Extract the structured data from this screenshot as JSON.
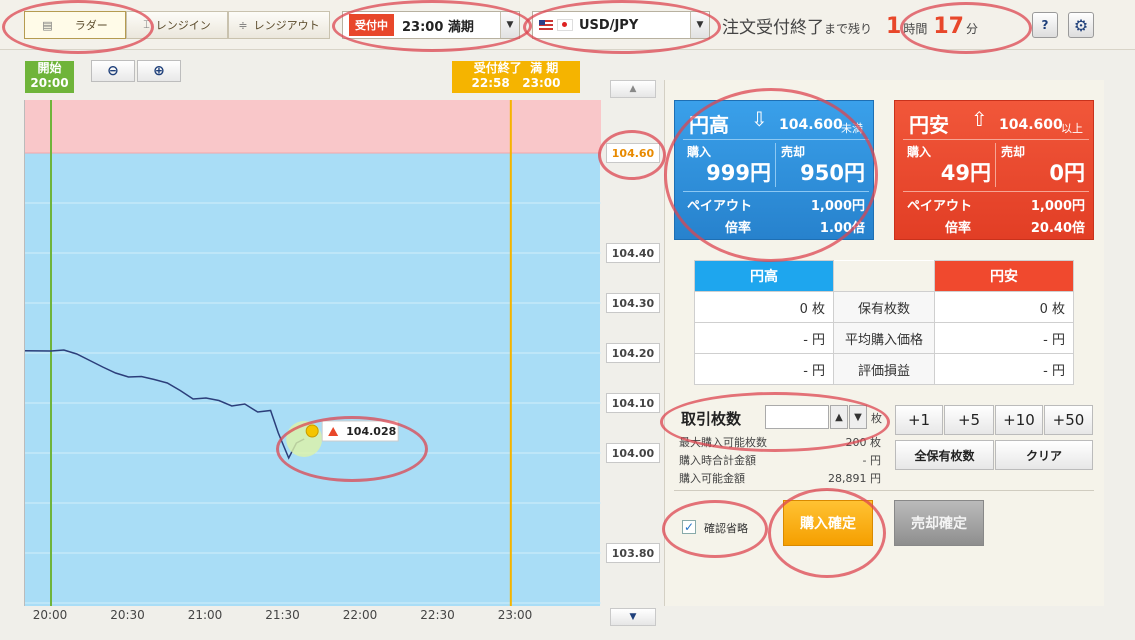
{
  "toolbar": {
    "tabs": [
      "ラダー",
      "レンジイン",
      "レンジアウト"
    ],
    "status_badge": "受付中",
    "expiry": "23:00 満期",
    "pair": "USD/JPY",
    "remaining_label": "注文受付終了",
    "remaining_suffix": "まで残り",
    "hours": "1",
    "hours_unit": "時間",
    "minutes": "17",
    "minutes_unit": "分",
    "help": "?",
    "settings_icon": "gear-icon"
  },
  "chart_data": {
    "type": "line",
    "start_tag": {
      "title": "開始",
      "time": "20:00"
    },
    "end_tag": {
      "title": "受付終了  満 期",
      "time": "22:58   23:00"
    },
    "current_price": "104.028",
    "price_labels": [
      "104.60",
      "104.40",
      "104.30",
      "104.20",
      "104.10",
      "104.00",
      "103.80"
    ],
    "x_ticks": [
      "20:00",
      "20:30",
      "21:00",
      "21:30",
      "22:00",
      "22:30",
      "23:00"
    ],
    "series": [
      {
        "values": [
          [
            "20:00",
            104.204
          ],
          [
            "20:05",
            104.206
          ],
          [
            "20:10",
            104.198
          ],
          [
            "20:15",
            104.185
          ],
          [
            "20:20",
            104.172
          ],
          [
            "20:25",
            104.16
          ],
          [
            "20:30",
            104.152
          ],
          [
            "20:35",
            104.153
          ],
          [
            "20:40",
            104.147
          ],
          [
            "20:45",
            104.14
          ],
          [
            "20:50",
            104.125
          ],
          [
            "20:55",
            104.108
          ],
          [
            "21:00",
            104.11
          ],
          [
            "21:05",
            104.105
          ],
          [
            "21:10",
            104.094
          ],
          [
            "21:15",
            104.098
          ],
          [
            "21:20",
            104.082
          ],
          [
            "21:25",
            104.085
          ],
          [
            "21:28",
            104.04
          ],
          [
            "21:32",
            103.99
          ],
          [
            "21:35",
            104.02
          ],
          [
            "21:38",
            104.028
          ]
        ]
      }
    ]
  },
  "ladder": {
    "yen_high": {
      "title": "円高",
      "strike": "104.600",
      "cond": "未満",
      "buy_label": "購入",
      "sell_label": "売却",
      "buy": "999円",
      "sell": "950円",
      "payout_label": "ペイアウト",
      "payout": "1,000円",
      "rate_label": "倍率",
      "rate": "1.00倍"
    },
    "yen_low": {
      "title": "円安",
      "strike": "104.600",
      "cond": "以上",
      "buy_label": "購入",
      "sell_label": "売却",
      "buy": "49円",
      "sell": "0円",
      "payout_label": "ペイアウト",
      "payout": "1,000円",
      "rate_label": "倍率",
      "rate": "20.40倍"
    }
  },
  "holdings": {
    "col_high": "円高",
    "col_low": "円安",
    "rows": [
      {
        "label": "保有枚数",
        "high": "0 枚",
        "low": "0 枚"
      },
      {
        "label": "平均購入価格",
        "high": "- 円",
        "low": "- 円"
      },
      {
        "label": "評価損益",
        "high": "- 円",
        "low": "- 円"
      }
    ]
  },
  "trade": {
    "qty_label": "取引枚数",
    "qty_value": "",
    "qty_unit": "枚",
    "inc_buttons": [
      "+1",
      "+5",
      "+10",
      "+50"
    ],
    "all_holdings": "全保有枚数",
    "clear": "クリア",
    "info": [
      {
        "label": "最大購入可能枚数",
        "value": "200 枚"
      },
      {
        "label": "購入時合計金額",
        "value": "- 円"
      },
      {
        "label": "購入可能金額",
        "value": "28,891 円"
      }
    ],
    "skip_confirm": "確認省略",
    "buy_confirm": "購入確定",
    "sell_confirm": "売却確定"
  },
  "colors": {
    "blue": "#2a8fd9",
    "red": "#e94a31",
    "orange": "#f5a800",
    "green": "#6fb43a"
  }
}
